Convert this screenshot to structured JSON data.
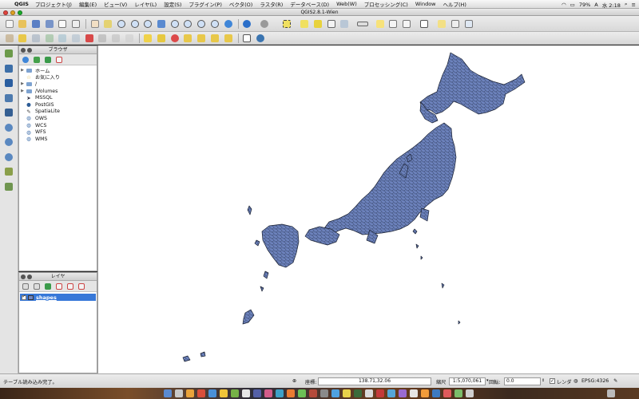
{
  "menubar": {
    "app_name": "QGIS",
    "items": [
      "プロジェクト(J)",
      "編集(E)",
      "ビュー(V)",
      "レイヤ(L)",
      "設定(S)",
      "プラグイン(P)",
      "ベクタ(O)",
      "ラスタ(R)",
      "データベース(D)",
      "Web(W)",
      "プロセッシング(C)",
      "Window",
      "ヘルプ(H)"
    ],
    "battery": "79%",
    "clock": "水 2:18"
  },
  "window": {
    "title": "QGIS2.8.1-Wien"
  },
  "browser_panel": {
    "title": "ブラウザ",
    "items": [
      {
        "label": "ホーム",
        "icon": "folder-icon",
        "expandable": true
      },
      {
        "label": "お気に入り",
        "icon": "star-icon",
        "expandable": false
      },
      {
        "label": "/",
        "icon": "folder-icon",
        "expandable": true
      },
      {
        "label": "/Volumes",
        "icon": "folder-icon",
        "expandable": true
      },
      {
        "label": "MSSQL",
        "icon": "mssql-icon",
        "expandable": false
      },
      {
        "label": "PostGIS",
        "icon": "postgis-icon",
        "expandable": false
      },
      {
        "label": "SpatiaLite",
        "icon": "spatialite-icon",
        "expandable": false
      },
      {
        "label": "OWS",
        "icon": "globe-icon",
        "expandable": false
      },
      {
        "label": "WCS",
        "icon": "globe-icon",
        "expandable": false
      },
      {
        "label": "WFS",
        "icon": "globe-icon",
        "expandable": false
      },
      {
        "label": "WMS",
        "icon": "globe-icon",
        "expandable": false
      }
    ]
  },
  "layers_panel": {
    "title": "レイヤ",
    "layers": [
      {
        "name": "shapes",
        "visible": true,
        "fill_color": "#7186c0"
      }
    ]
  },
  "map": {
    "fill_color": "#6e84bf",
    "stroke_color": "#1b2233"
  },
  "statusbar": {
    "message": "テーブル読み込み完了。",
    "coord_label": "座標:",
    "coord_value": "138.71,32.06",
    "scale_label": "縮尺",
    "scale_value": "1:5,070,061",
    "rotation_label": "回転:",
    "rotation_value": "0.0",
    "render_label": "レンダ",
    "render_checked": true,
    "crs_label": "EPSG:4326"
  }
}
